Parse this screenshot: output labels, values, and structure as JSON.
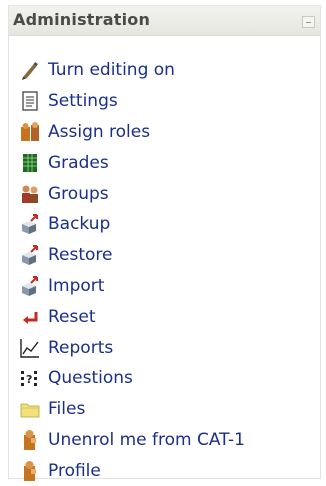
{
  "block": {
    "title": "Administration",
    "items": [
      {
        "label": "Turn editing on",
        "icon": "edit-pencil-icon"
      },
      {
        "label": "Settings",
        "icon": "settings-document-icon"
      },
      {
        "label": "Assign roles",
        "icon": "assign-roles-icon"
      },
      {
        "label": "Grades",
        "icon": "grades-spreadsheet-icon"
      },
      {
        "label": "Groups",
        "icon": "groups-people-icon"
      },
      {
        "label": "Backup",
        "icon": "backup-box-icon"
      },
      {
        "label": "Restore",
        "icon": "restore-box-icon"
      },
      {
        "label": "Import",
        "icon": "import-box-icon"
      },
      {
        "label": "Reset",
        "icon": "reset-arrow-icon"
      },
      {
        "label": "Reports",
        "icon": "reports-chart-icon"
      },
      {
        "label": "Questions",
        "icon": "questions-icon"
      },
      {
        "label": "Files",
        "icon": "folder-icon"
      },
      {
        "label": "Unenrol me from CAT-1",
        "icon": "unenrol-user-icon"
      },
      {
        "label": "Profile",
        "icon": "profile-user-icon"
      }
    ]
  },
  "colors": {
    "link": "#1a2f8a",
    "title": "#4a4a4a",
    "header_bg": "#e9e9e2"
  }
}
